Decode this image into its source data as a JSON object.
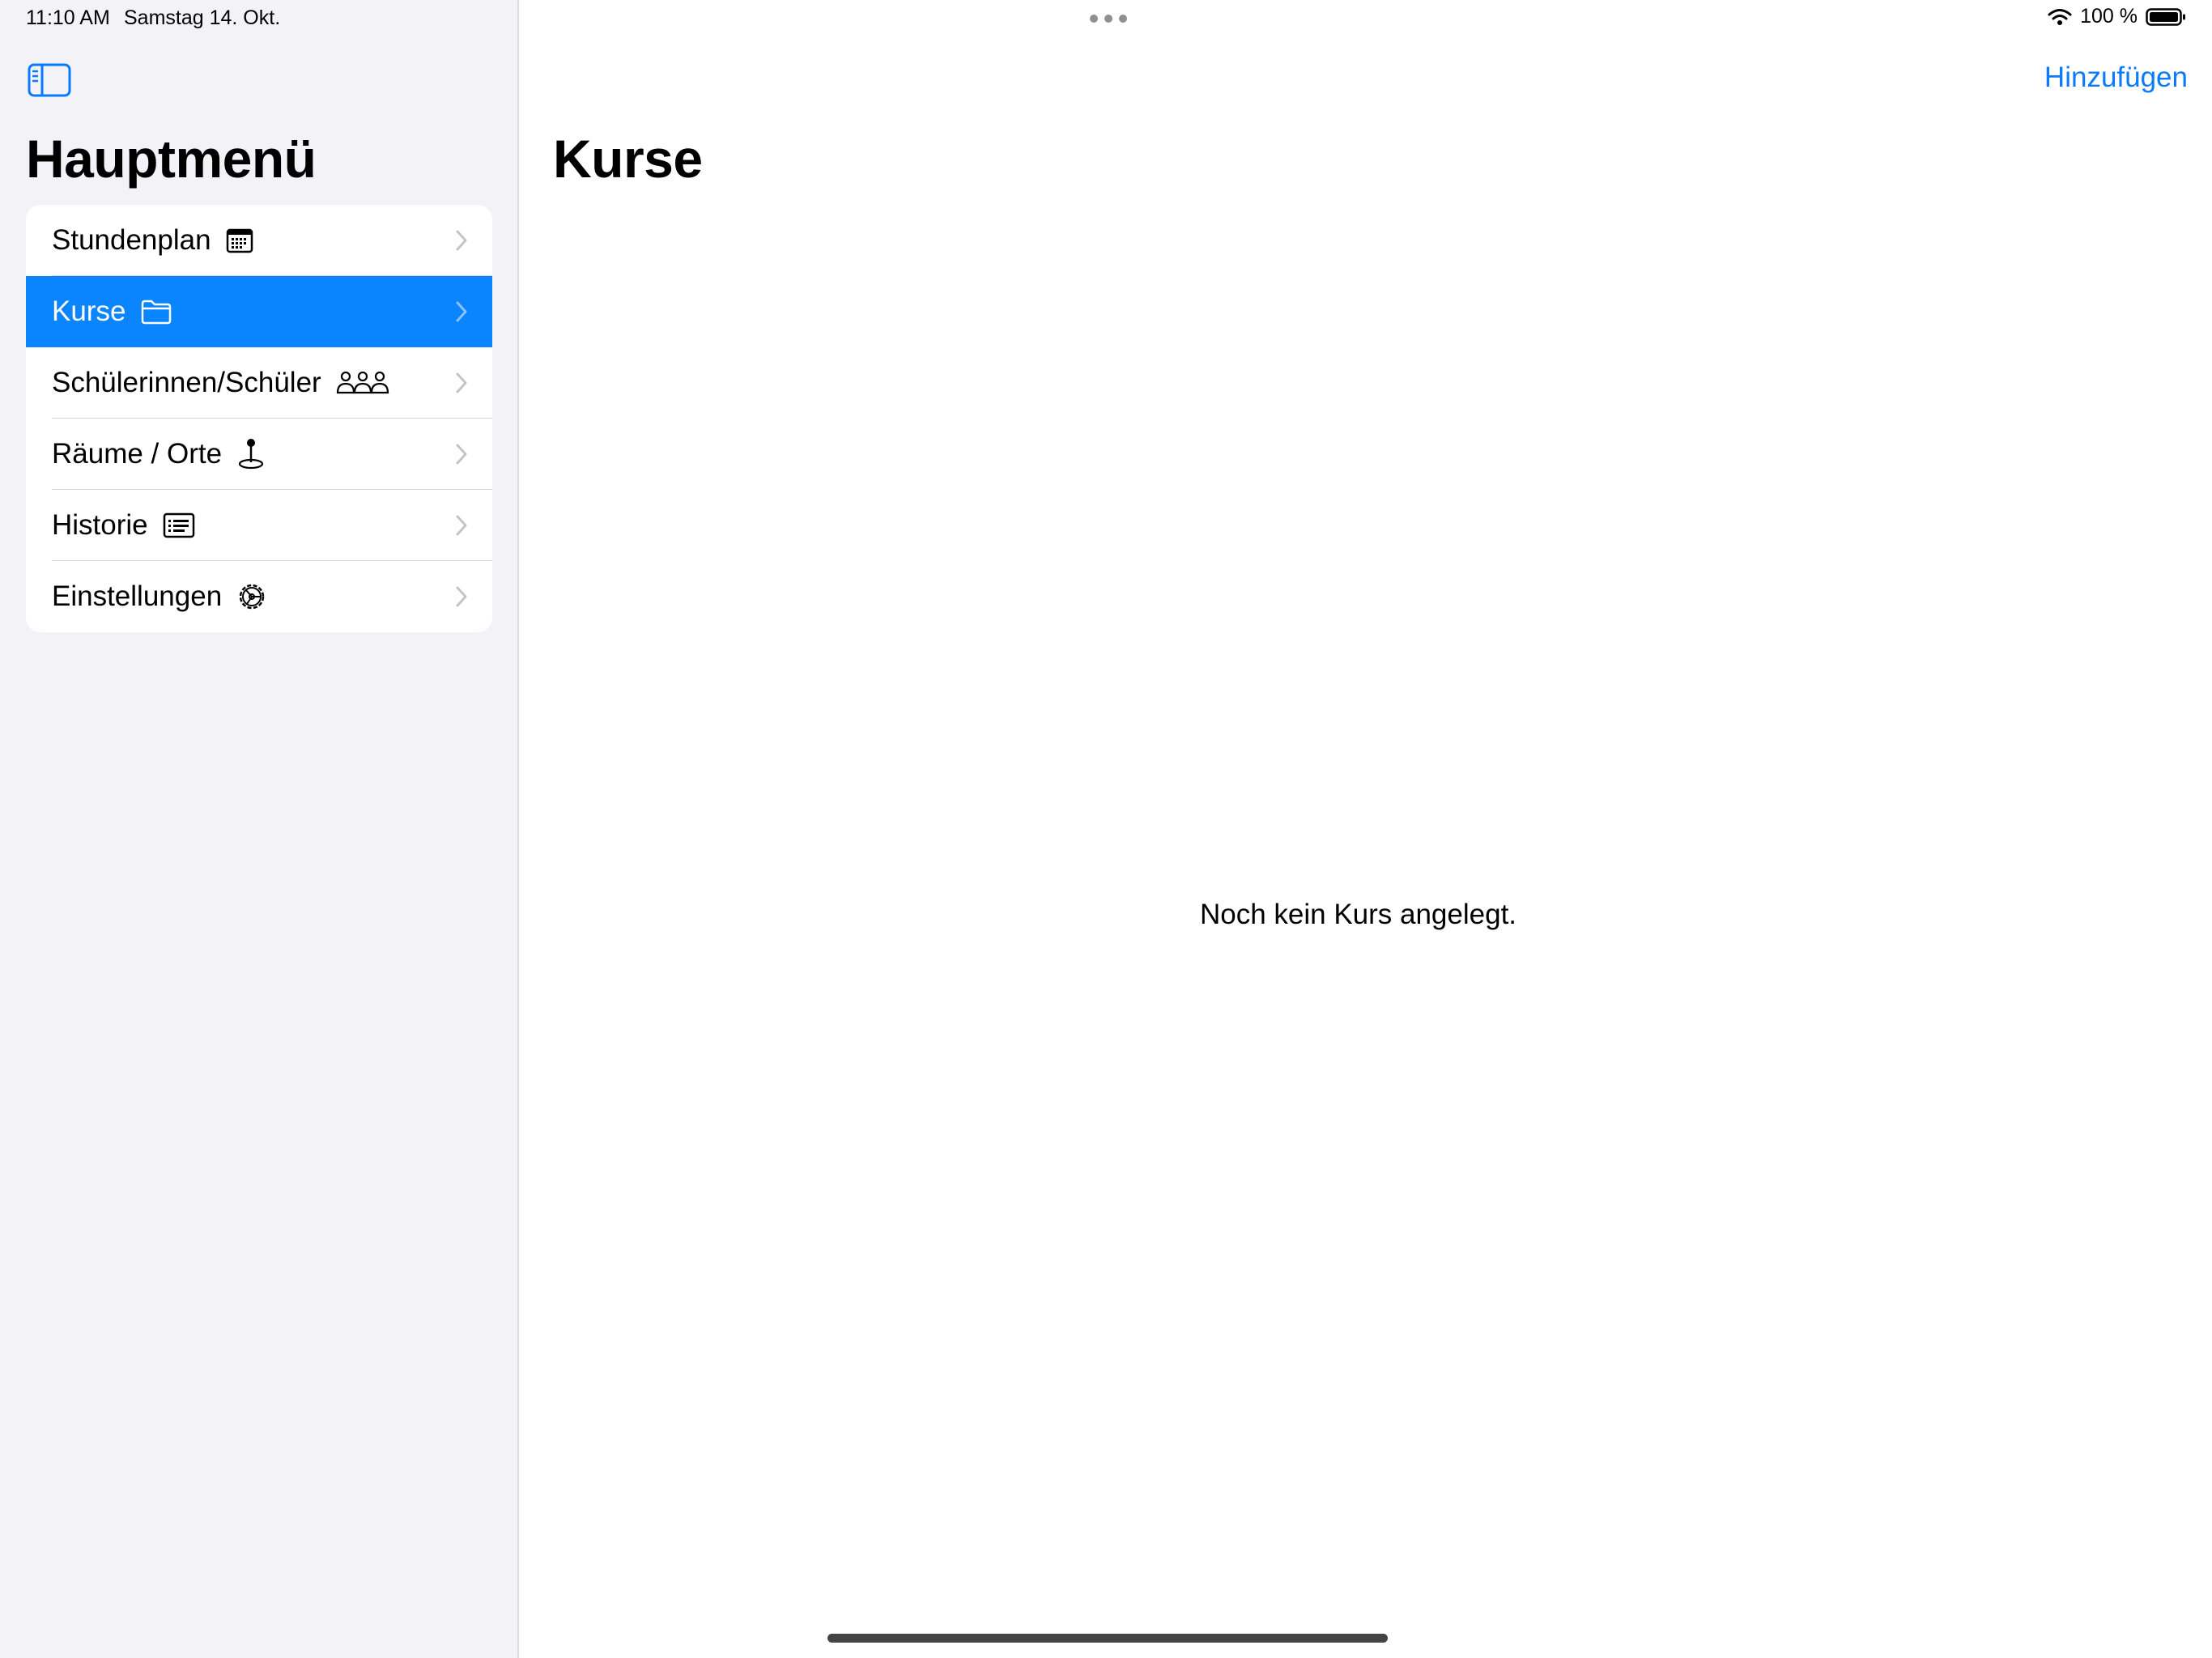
{
  "status_bar": {
    "time": "11:10 AM",
    "date": "Samstag 14. Okt.",
    "battery_percent": "100 %",
    "battery_level": 1.0
  },
  "sidebar": {
    "toggle_icon": "sidebar-icon",
    "title": "Hauptmenü",
    "items": [
      {
        "label": "Stundenplan",
        "icon": "calendar-icon",
        "selected": false
      },
      {
        "label": "Kurse",
        "icon": "folder-icon",
        "selected": true
      },
      {
        "label": "Schülerinnen/Schüler",
        "icon": "people-icon",
        "selected": false
      },
      {
        "label": "Räume / Orte",
        "icon": "map-pin-icon",
        "selected": false
      },
      {
        "label": "Historie",
        "icon": "list-icon",
        "selected": false
      },
      {
        "label": "Einstellungen",
        "icon": "gear-icon",
        "selected": false
      }
    ]
  },
  "main": {
    "add_label": "Hinzufügen",
    "title": "Kurse",
    "empty_message": "Noch kein Kurs angelegt."
  },
  "colors": {
    "accent": "#0a84ff",
    "link": "#0a7aff",
    "sidebar_bg": "#f2f2f7",
    "chevron": "#c4c4c7"
  }
}
